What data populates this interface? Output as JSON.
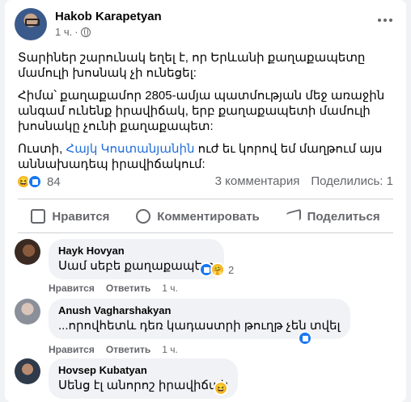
{
  "post": {
    "author": "Hakob Karapetyan",
    "time": "1 ч.",
    "paragraphs": [
      "Տարիներ շարունակ եղել է, որ Երևանի քաղաքապետը մամուլի խոսնակ չի ունեցել:",
      "Հիմա՝ քաղաքամոր 2805-ամյա պատմության մեջ առաջին անգամ ունենք իրավիճակ, երբ քաղաքապետի մամուլի խոսնակը չունի քաղաքապետ:"
    ],
    "p3_prefix": "Ուստի, ",
    "p3_link": "Հայկ Կոստանյանին",
    "p3_suffix": " ուժ եւ կորով եմ մաղթում այս աննախադեպ իրավիճակում:",
    "reaction_count": "84",
    "comments_count": "3 комментария",
    "shares_count": "Поделились: 1"
  },
  "actions": {
    "like": "Нравится",
    "comment": "Комментировать",
    "share": "Поделиться"
  },
  "comments": [
    {
      "name": "Hayk Hovyan",
      "text": "Սամ սեբե քաղաքապետ",
      "like": "Нравится",
      "reply": "Ответить",
      "time": "1 ч.",
      "reaction_count": "2"
    },
    {
      "name": "Anush Vagharshakyan",
      "text": "...որովհետև դեռ կադաստրի թուղթ չեն տվել",
      "like": "Нравится",
      "reply": "Ответить",
      "time": "1 ч."
    },
    {
      "name": "Hovsep Kubatyan",
      "text": "Սենց էլ անորոշ իրավիճակ"
    }
  ],
  "colors": {
    "brand_blue": "#1877f2",
    "link": "#216fdb",
    "haha_yellow": "#f7b928",
    "muted": "#65676b"
  }
}
